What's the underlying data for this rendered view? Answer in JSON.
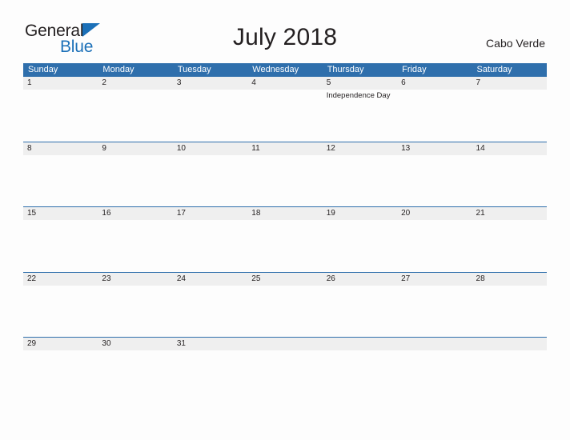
{
  "brand": {
    "name_part1": "General",
    "name_part2": "Blue",
    "triangle_color": "#1b70b8"
  },
  "header": {
    "title": "July 2018",
    "locale": "Cabo Verde"
  },
  "theme": {
    "header_blue": "#2f6fac",
    "row_band_gray": "#efefef",
    "page_background": "#fdfdfd",
    "text_color": "#231f20"
  },
  "calendar": {
    "month": "July",
    "year": "2018",
    "weekdays": [
      "Sunday",
      "Monday",
      "Tuesday",
      "Wednesday",
      "Thursday",
      "Friday",
      "Saturday"
    ],
    "weeks": [
      [
        {
          "day": "1",
          "events": []
        },
        {
          "day": "2",
          "events": []
        },
        {
          "day": "3",
          "events": []
        },
        {
          "day": "4",
          "events": []
        },
        {
          "day": "5",
          "events": [
            "Independence Day"
          ]
        },
        {
          "day": "6",
          "events": []
        },
        {
          "day": "7",
          "events": []
        }
      ],
      [
        {
          "day": "8",
          "events": []
        },
        {
          "day": "9",
          "events": []
        },
        {
          "day": "10",
          "events": []
        },
        {
          "day": "11",
          "events": []
        },
        {
          "day": "12",
          "events": []
        },
        {
          "day": "13",
          "events": []
        },
        {
          "day": "14",
          "events": []
        }
      ],
      [
        {
          "day": "15",
          "events": []
        },
        {
          "day": "16",
          "events": []
        },
        {
          "day": "17",
          "events": []
        },
        {
          "day": "18",
          "events": []
        },
        {
          "day": "19",
          "events": []
        },
        {
          "day": "20",
          "events": []
        },
        {
          "day": "21",
          "events": []
        }
      ],
      [
        {
          "day": "22",
          "events": []
        },
        {
          "day": "23",
          "events": []
        },
        {
          "day": "24",
          "events": []
        },
        {
          "day": "25",
          "events": []
        },
        {
          "day": "26",
          "events": []
        },
        {
          "day": "27",
          "events": []
        },
        {
          "day": "28",
          "events": []
        }
      ],
      [
        {
          "day": "29",
          "events": []
        },
        {
          "day": "30",
          "events": []
        },
        {
          "day": "31",
          "events": []
        },
        {
          "day": "",
          "events": []
        },
        {
          "day": "",
          "events": []
        },
        {
          "day": "",
          "events": []
        },
        {
          "day": "",
          "events": []
        }
      ]
    ]
  }
}
